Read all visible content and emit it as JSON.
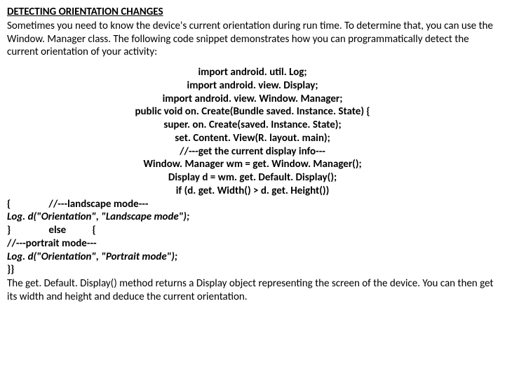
{
  "heading": "DETECTING ORIENTATION CHANGES",
  "intro": "Sometimes you need to know the device's current orientation during run time. To determine that, you can use the Window. Manager class. The following code snippet demonstrates how you can programmatically detect the current orientation of your activity:",
  "code_centered": [
    "import android. util. Log;",
    "import android. view. Display;",
    "import android. view. Window. Manager;",
    "public void on. Create(Bundle saved. Instance. State) {",
    "super. on. Create(saved. Instance. State);",
    "set. Content. View(R. layout. main);",
    "//---get the current display info---",
    "Window. Manager wm = get. Window. Manager();",
    "Display d = wm. get. Default. Display();",
    "if (d. get. Width() > d. get. Height())"
  ],
  "code_left": [
    {
      "text": "{                //---landscape mode---",
      "italic": false
    },
    {
      "text": "Log. d(\"Orientation\", \"Landscape mode\");",
      "italic": true
    },
    {
      "text": "}                else           {",
      "italic": false
    },
    {
      "text": "//---portrait mode---",
      "italic": false
    },
    {
      "text": "Log. d(\"Orientation\", \"Portrait mode\");",
      "italic": true
    },
    {
      "text": "}}",
      "italic": false
    }
  ],
  "outro": "The get. Default. Display() method returns a Display object representing the screen of the device. You can then get its width and height and deduce the current orientation."
}
